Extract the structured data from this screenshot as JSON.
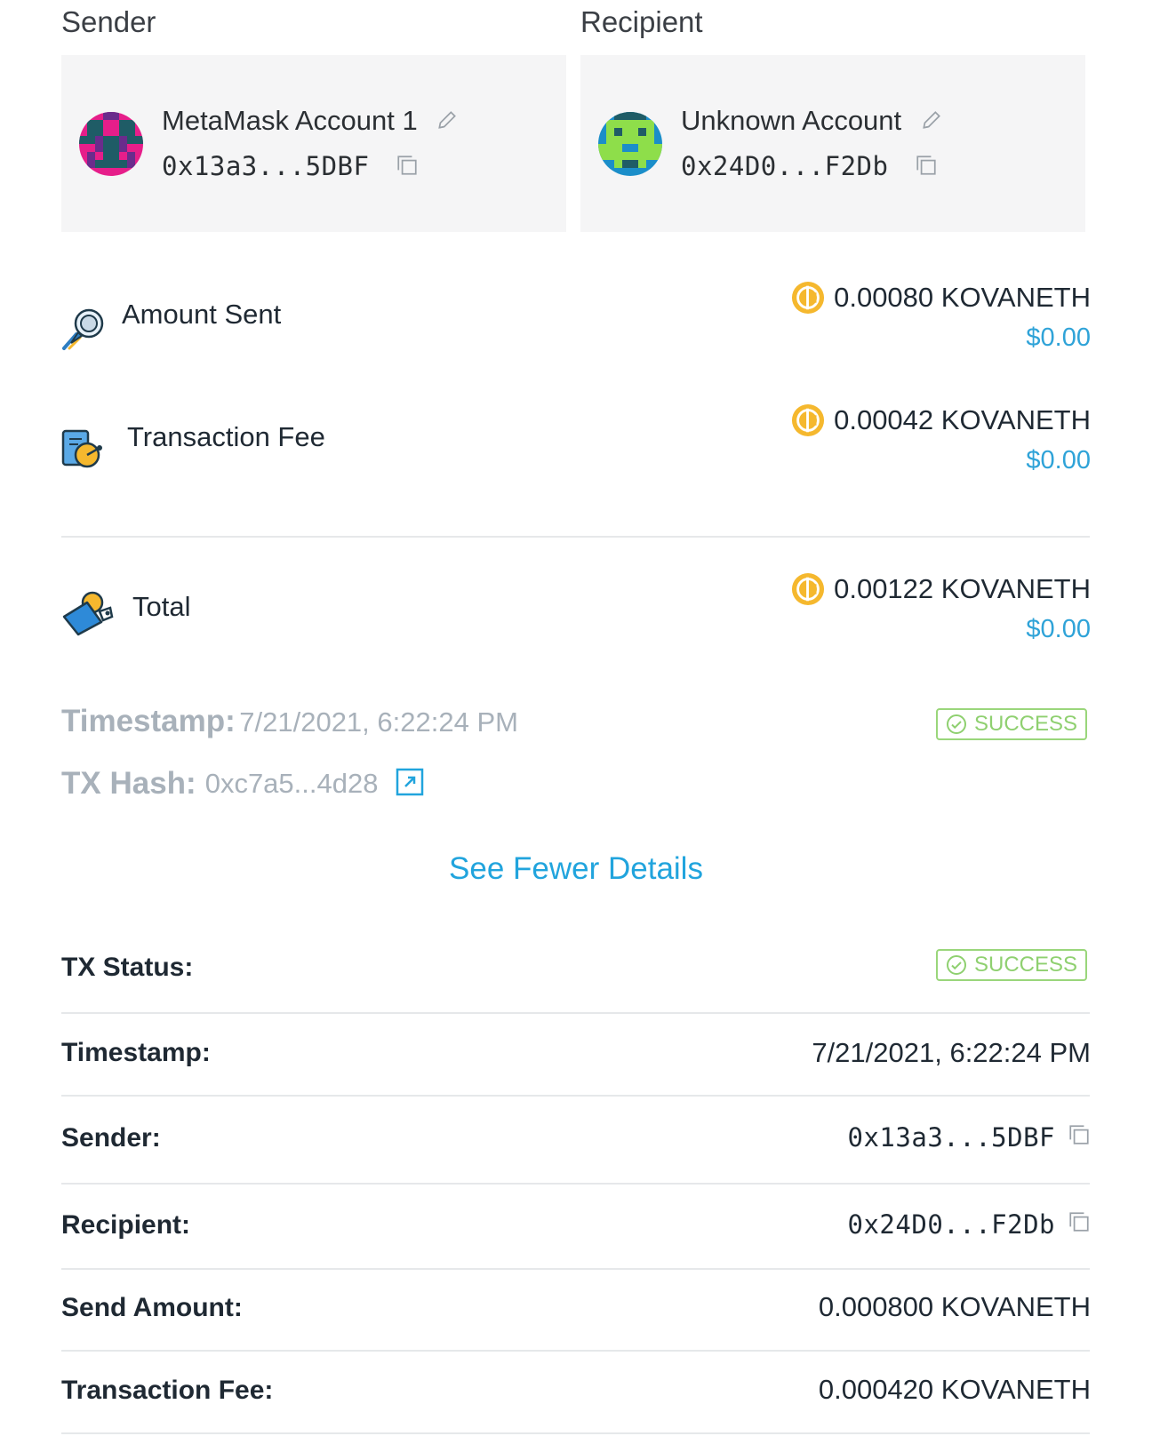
{
  "sender": {
    "title": "Sender",
    "name": "MetaMask Account 1",
    "address": "0x13a3...5DBF"
  },
  "recipient": {
    "title": "Recipient",
    "name": "Unknown Account",
    "address": "0x24D0...F2Db"
  },
  "summary": {
    "amount_sent": {
      "label": "Amount Sent",
      "value": "0.00080 KOVANETH",
      "fiat": "$0.00"
    },
    "transaction_fee": {
      "label": "Transaction Fee",
      "value": "0.00042 KOVANETH",
      "fiat": "$0.00"
    },
    "total": {
      "label": "Total",
      "value": "0.00122 KOVANETH",
      "fiat": "$0.00"
    }
  },
  "meta": {
    "timestamp_label": "Timestamp:",
    "timestamp_value": "7/21/2021, 6:22:24 PM",
    "hash_label": "TX Hash:",
    "hash_value": "0xc7a5...4d28",
    "status": "SUCCESS"
  },
  "toggle_link": "See Fewer Details",
  "details": {
    "status_label": "TX Status:",
    "status_value": "SUCCESS",
    "timestamp_label": "Timestamp:",
    "timestamp_value": "7/21/2021, 6:22:24 PM",
    "sender_label": "Sender:",
    "sender_value": "0x13a3...5DBF",
    "recipient_label": "Recipient:",
    "recipient_value": "0x24D0...F2Db",
    "send_amount_label": "Send Amount:",
    "send_amount_value": "0.000800 KOVANETH",
    "fee_label": "Transaction Fee:",
    "fee_value": "0.000420 KOVANETH"
  },
  "colors": {
    "accent_blue": "#21a4dd",
    "fiat_blue": "#2fa3d8",
    "success_green": "#8fd070",
    "coin_gold": "#f5b82e",
    "card_bg": "#f5f5f6"
  }
}
